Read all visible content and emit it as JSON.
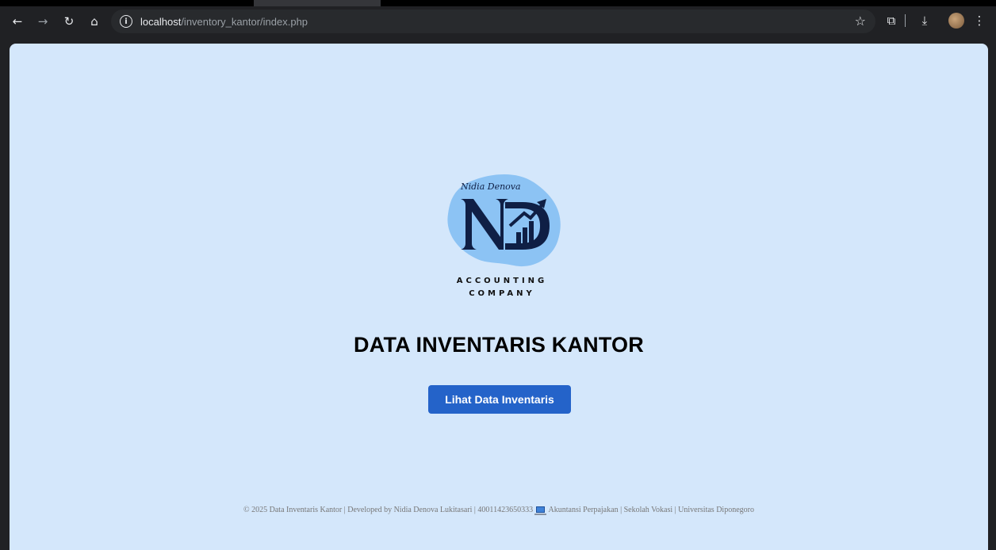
{
  "browser": {
    "back_icon": "←",
    "forward_icon": "→",
    "reload_icon": "↻",
    "home_icon": "⌂",
    "url_host": "localhost",
    "url_path": "/inventory_kantor/index.php",
    "bookmark_icon": "☆",
    "extensions_icon": "⧉",
    "download_icon": "⤓",
    "menu_icon": "⋮"
  },
  "logo": {
    "script_text": "Nidia Denova",
    "monogram": "ND",
    "line1": "ACCOUNTING",
    "line2": "COMPANY",
    "colors": {
      "navy": "#0f1f45",
      "blob": "#8cc3f4"
    }
  },
  "main": {
    "title": "DATA INVENTARIS KANTOR",
    "button_label": "Lihat Data Inventaris"
  },
  "footer": {
    "text_before_icon": "© 2025 Data Inventaris Kantor | Developed by Nidia Denova Lukitasari | 40011423650333",
    "text_after_icon": "Akuntansi Perpajakan | Sekolah Vokasi | Universitas Diponegoro"
  },
  "colors": {
    "page_bg": "#d4e7fb",
    "button_bg": "#2463c9",
    "chrome_bg": "#202124"
  }
}
